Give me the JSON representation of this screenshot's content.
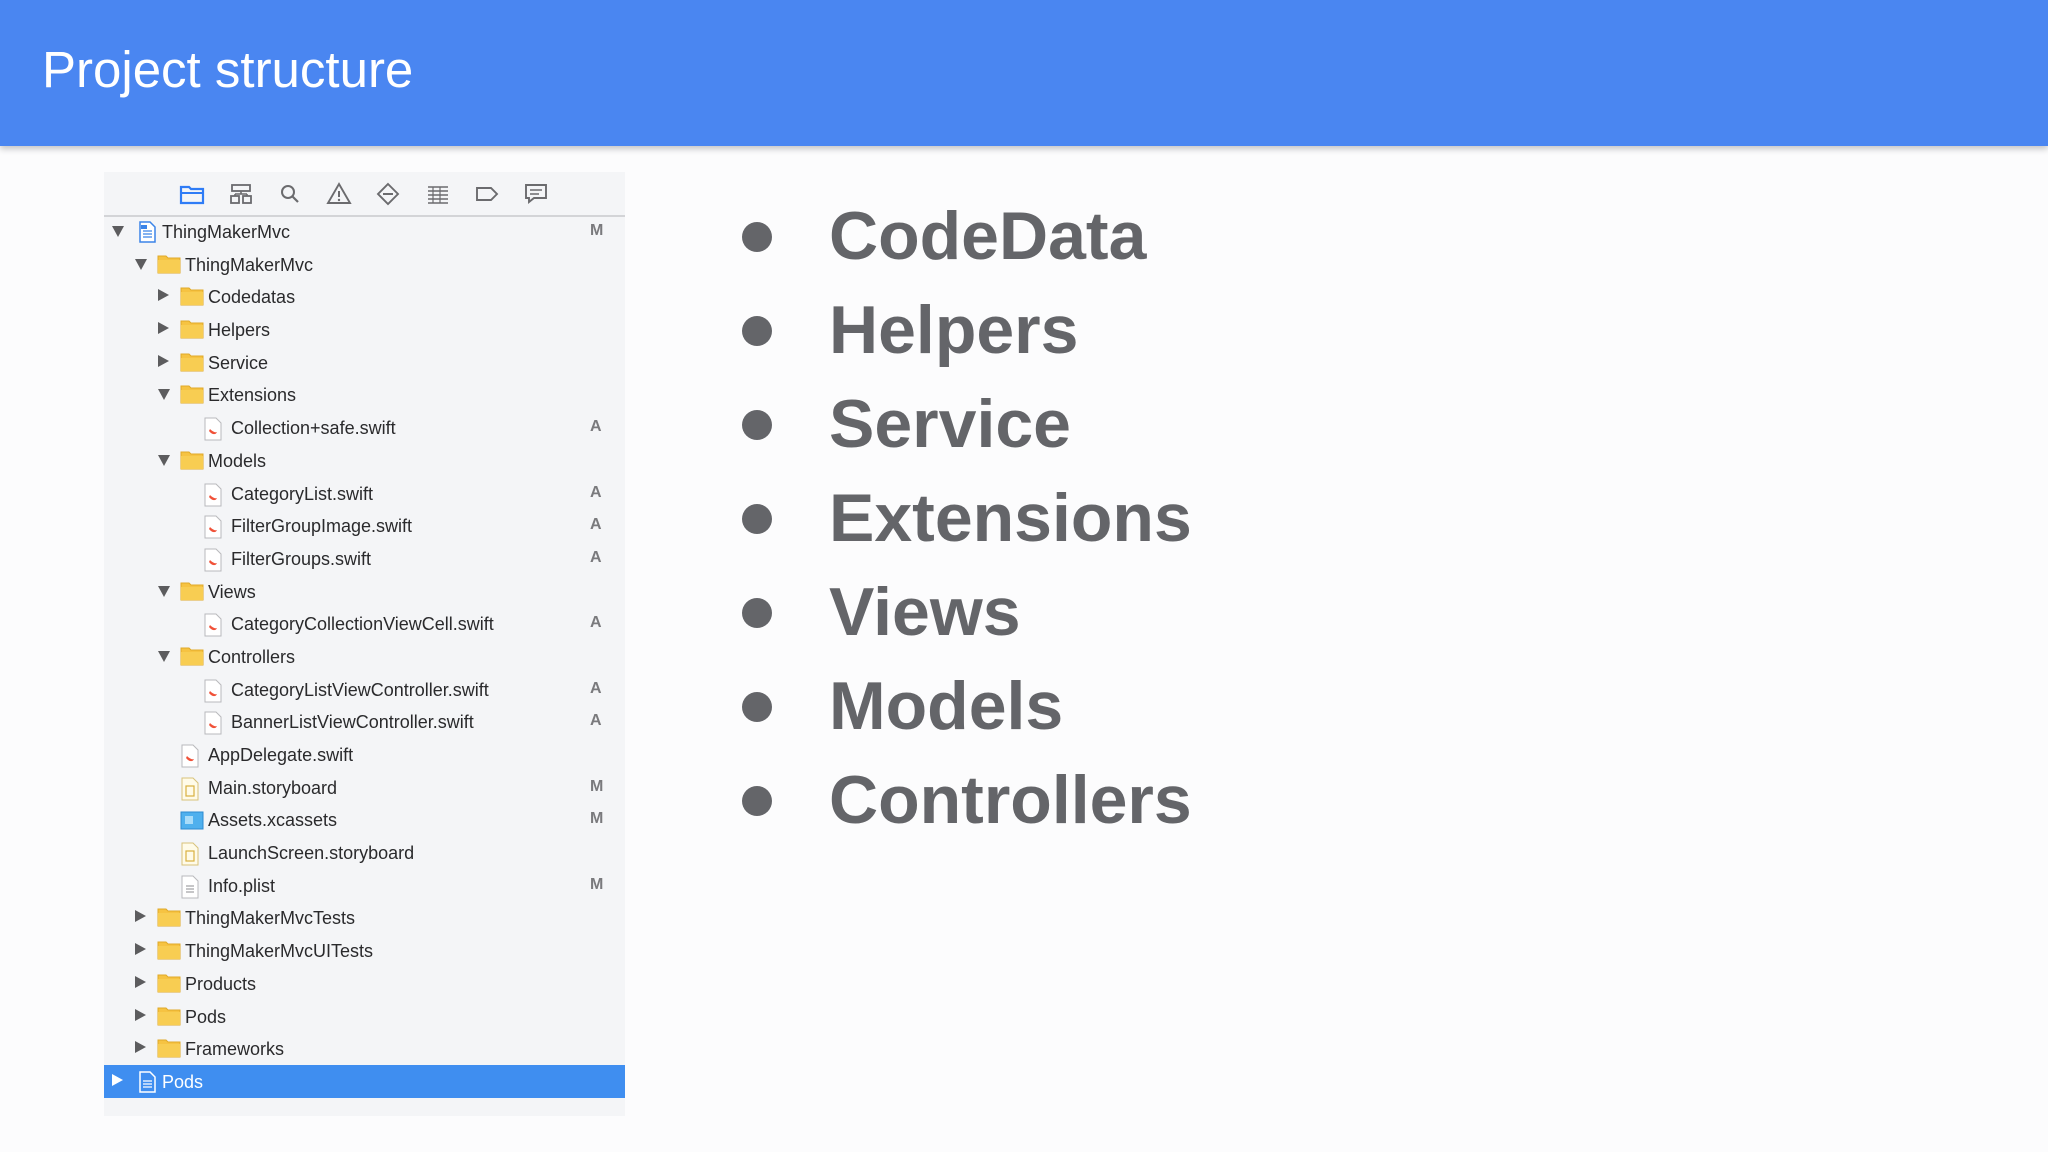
{
  "slide": {
    "title": "Project structure"
  },
  "toolbar": {
    "icons": [
      "folder-icon",
      "hierarchy-icon",
      "search-icon",
      "warning-icon",
      "diamond-icon",
      "list-icon",
      "tag-icon",
      "message-icon"
    ]
  },
  "tree": [
    {
      "label": "ThingMakerMvc",
      "kind": "project",
      "depth": 0,
      "disclosure": "open",
      "status": "M"
    },
    {
      "label": "ThingMakerMvc",
      "kind": "folder",
      "depth": 1,
      "disclosure": "open",
      "status": ""
    },
    {
      "label": "Codedatas",
      "kind": "folder",
      "depth": 2,
      "disclosure": "closed",
      "status": ""
    },
    {
      "label": "Helpers",
      "kind": "folder",
      "depth": 2,
      "disclosure": "closed",
      "status": ""
    },
    {
      "label": "Service",
      "kind": "folder",
      "depth": 2,
      "disclosure": "closed",
      "status": ""
    },
    {
      "label": "Extensions",
      "kind": "folder",
      "depth": 2,
      "disclosure": "open",
      "status": ""
    },
    {
      "label": "Collection+safe.swift",
      "kind": "swift",
      "depth": 3,
      "disclosure": "none",
      "status": "A"
    },
    {
      "label": "Models",
      "kind": "folder",
      "depth": 2,
      "disclosure": "open",
      "status": ""
    },
    {
      "label": "CategoryList.swift",
      "kind": "swift",
      "depth": 3,
      "disclosure": "none",
      "status": "A"
    },
    {
      "label": "FilterGroupImage.swift",
      "kind": "swift",
      "depth": 3,
      "disclosure": "none",
      "status": "A"
    },
    {
      "label": "FilterGroups.swift",
      "kind": "swift",
      "depth": 3,
      "disclosure": "none",
      "status": "A"
    },
    {
      "label": "Views",
      "kind": "folder",
      "depth": 2,
      "disclosure": "open",
      "status": ""
    },
    {
      "label": "CategoryCollectionViewCell.swift",
      "kind": "swift",
      "depth": 3,
      "disclosure": "none",
      "status": "A"
    },
    {
      "label": "Controllers",
      "kind": "folder",
      "depth": 2,
      "disclosure": "open",
      "status": ""
    },
    {
      "label": "CategoryListViewController.swift",
      "kind": "swift",
      "depth": 3,
      "disclosure": "none",
      "status": "A"
    },
    {
      "label": "BannerListViewController.swift",
      "kind": "swift",
      "depth": 3,
      "disclosure": "none",
      "status": "A"
    },
    {
      "label": "AppDelegate.swift",
      "kind": "swift",
      "depth": 2,
      "disclosure": "none",
      "status": ""
    },
    {
      "label": "Main.storyboard",
      "kind": "storyboard",
      "depth": 2,
      "disclosure": "none",
      "status": "M"
    },
    {
      "label": "Assets.xcassets",
      "kind": "assets",
      "depth": 2,
      "disclosure": "none",
      "status": "M"
    },
    {
      "label": "LaunchScreen.storyboard",
      "kind": "storyboard",
      "depth": 2,
      "disclosure": "none",
      "status": ""
    },
    {
      "label": "Info.plist",
      "kind": "plist",
      "depth": 2,
      "disclosure": "none",
      "status": "M"
    },
    {
      "label": "ThingMakerMvcTests",
      "kind": "folder",
      "depth": 1,
      "disclosure": "closed",
      "status": ""
    },
    {
      "label": "ThingMakerMvcUITests",
      "kind": "folder",
      "depth": 1,
      "disclosure": "closed",
      "status": ""
    },
    {
      "label": "Products",
      "kind": "folder",
      "depth": 1,
      "disclosure": "closed",
      "status": ""
    },
    {
      "label": "Pods",
      "kind": "folder",
      "depth": 1,
      "disclosure": "closed",
      "status": ""
    },
    {
      "label": "Frameworks",
      "kind": "folder",
      "depth": 1,
      "disclosure": "closed",
      "status": ""
    },
    {
      "label": "Pods",
      "kind": "project",
      "depth": 0,
      "disclosure": "closed",
      "status": "",
      "selected": true
    }
  ],
  "bullets": [
    "CodeData",
    "Helpers",
    "Service",
    "Extensions",
    "Views",
    "Models",
    "Controllers"
  ],
  "colors": {
    "header": "#4a86f1",
    "selection": "#3f8ef0",
    "folder": "#f6c342",
    "bullet_text": "#646569"
  }
}
